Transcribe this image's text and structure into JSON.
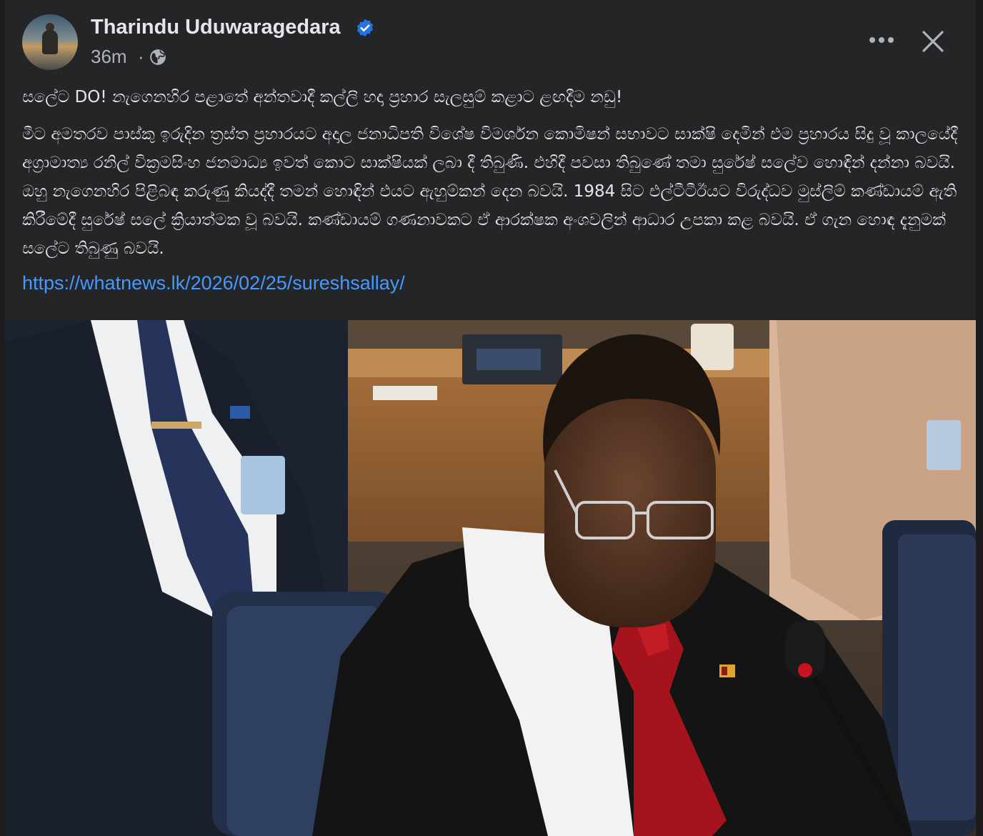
{
  "post": {
    "author": "Tharindu Uduwaragedara",
    "verified": true,
    "time": "36m",
    "separator": "·",
    "privacy_icon": "globe-icon",
    "title": "සලේට DO! නැගෙනහිර පළාතේ අන්තවාදී කල්ලි හදා ප්‍රහාර සැලසුම් කළාට ළඟදීම නඩු!",
    "paragraph": "මීට අමතරව පාස්කු ඉරුදින ත්‍රස්ත ප්‍රහාරයට අදාල ජනාධිපති විශේෂ විමර්ශන කොමිෂන් සභාවට සාක්ෂි දෙමින් එම ප්‍රහාරය සිදු වූ කාලයේදී අග්‍රාමාත්‍ය රනිල් වික්‍රමසිංහ ජනමාධ්‍ය ඉවත් කොට සාක්ෂියක් ලබා දී තිබුණි. එහිදී පවසා තිබුණේ තමා සුරේෂ් සලේව හොඳින් දන්නා බවයි. ඔහු නැගෙනහිර පිළිබඳ කරුණු කියද්දී තමන් හොඳින් එයට ඇහුම්කන් දෙන බවයි. 1984 සිට එල්ටීටීඊයට විරුද්ධව මුස්ලිම් කණ්ඩායම් ඇති කිරීමේදී සුරේෂ් සලේ ක්‍රියාත්මක වූ බවයි. කණ්ඩායම් ගණනාවකට ඒ ආරක්ෂක අංශවලින් ආධාර උපකා කළ බවයි. ඒ ගැන හොඳ දැනුමක් සලේට තිබුණු බවයි.",
    "link": "https://whatnews.lk/2026/02/25/sureshsallay/"
  },
  "icons": {
    "verified": "verified-badge-icon",
    "more": "more-options-icon",
    "close": "close-icon"
  },
  "colors": {
    "card_bg": "#242526",
    "text": "#e4e6eb",
    "secondary_text": "#b0b3b8",
    "link": "#4599ff",
    "verified": "#2374e1"
  }
}
